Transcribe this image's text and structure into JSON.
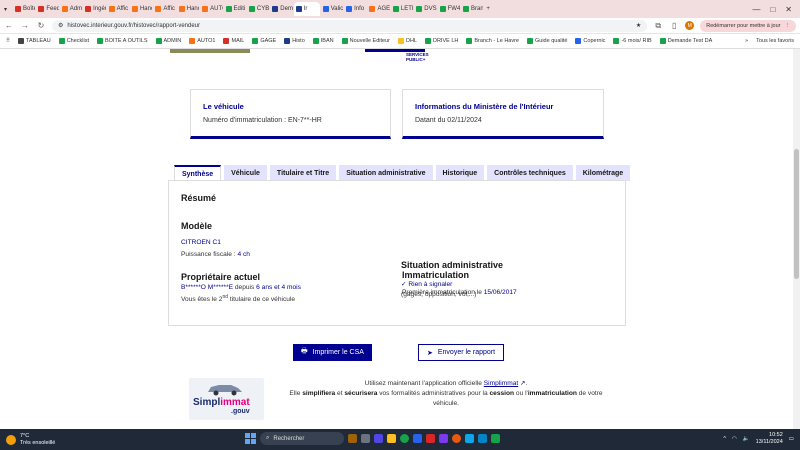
{
  "browser": {
    "tabs": [
      {
        "label": "Boîte",
        "color": "#d93025"
      },
      {
        "label": "Feedl",
        "color": "#d93025"
      },
      {
        "label": "Admi",
        "color": "#f97316"
      },
      {
        "label": "Ingér",
        "color": "#d93025"
      },
      {
        "label": "Affic",
        "color": "#f97316"
      },
      {
        "label": "Hano",
        "color": "#f97316"
      },
      {
        "label": "Affic",
        "color": "#f97316"
      },
      {
        "label": "Hano",
        "color": "#f97316"
      },
      {
        "label": "AUTC",
        "color": "#f97316"
      },
      {
        "label": "Editi",
        "color": "#16a34a"
      },
      {
        "label": "CYBI",
        "color": "#16a34a"
      },
      {
        "label": "Dem",
        "color": "#1e3a8a"
      },
      {
        "label": "Ir",
        "color": "#1e3a8a",
        "active": true
      },
      {
        "label": "Valic",
        "color": "#2563eb"
      },
      {
        "label": "Info",
        "color": "#2563eb"
      },
      {
        "label": "AGE",
        "color": "#f97316"
      },
      {
        "label": "LETI",
        "color": "#16a34a"
      },
      {
        "label": "DVSI",
        "color": "#16a34a"
      },
      {
        "label": "FW4",
        "color": "#16a34a"
      },
      {
        "label": "Bran",
        "color": "#16a34a"
      }
    ],
    "new_tab": "+",
    "window_controls": {
      "minimize": "—",
      "maximize": "□",
      "close": "✕"
    },
    "url": "histovec.interieur.gouv.fr/histovec/rapport-vendeur",
    "restart_label": "Redémarrer pour mettre à jour",
    "avatar_letter": "M",
    "more_menu": "⋮",
    "bookmarks": [
      {
        "label": "TABLEAU",
        "color": "#444"
      },
      {
        "label": "Checklist",
        "color": "#16a34a"
      },
      {
        "label": "BOITE A OUTILS",
        "color": "#16a34a"
      },
      {
        "label": "ADMIN",
        "color": "#16a34a"
      },
      {
        "label": "AUTO1",
        "color": "#f97316"
      },
      {
        "label": "MAIL",
        "color": "#d93025"
      },
      {
        "label": "GAGE",
        "color": "#16a34a"
      },
      {
        "label": "Histo",
        "color": "#1e3a8a"
      },
      {
        "label": "IBAN",
        "color": "#16a34a"
      },
      {
        "label": "Nouvelle Editeur",
        "color": "#16a34a"
      },
      {
        "label": "DHL",
        "color": "#fbbf24"
      },
      {
        "label": "DRIVE LH",
        "color": "#16a34a"
      },
      {
        "label": "Branch - Le Havre",
        "color": "#16a34a"
      },
      {
        "label": "Guide qualité",
        "color": "#16a34a"
      },
      {
        "label": "Copernic",
        "color": "#2563eb"
      },
      {
        "label": "-6 mois/ RIB",
        "color": "#16a34a"
      },
      {
        "label": "Demande Test DA",
        "color": "#16a34a"
      }
    ],
    "bookmarks_more": "»",
    "all_bookmarks": "Tous les favoris"
  },
  "header": {
    "logo_text": "SERVICES PUBLIC+"
  },
  "cards": {
    "vehicle": {
      "title": "Le véhicule",
      "text": "Numéro d'immatriculation : EN-7**-HR"
    },
    "ministry": {
      "title": "Informations du Ministère de l'Intérieur",
      "text": "Datant du 02/11/2024"
    }
  },
  "tabs": [
    "Synthèse",
    "Véhicule",
    "Titulaire et Titre",
    "Situation administrative",
    "Historique",
    "Contrôles techniques",
    "Kilométrage"
  ],
  "summary": {
    "title": "Résumé",
    "model_heading": "Modèle",
    "model": "CITROEN C1",
    "power_label": "Puissance fiscale : ",
    "power_value": "4 ch",
    "owner_heading": "Propriétaire actuel",
    "owner_name": "B******O M******E",
    "owner_since_pre": "depuis",
    "owner_since": "6 ans et 4 mois",
    "holder_pre": "Vous êtes le ",
    "holder_rank": "2",
    "holder_sup": "nd",
    "holder_post": " titulaire de ce véhicule",
    "registration_heading": "Immatriculation",
    "first_registration_label": "Première immatriculation le ",
    "first_registration_date": "15/06/2017",
    "admin_heading": "Situation administrative",
    "admin_status": "Rien à signaler",
    "admin_detail": "(gages, opposition, vol,...)"
  },
  "actions": {
    "print": "Imprimer le CSA",
    "send": "Envoyer le rapport"
  },
  "promo": {
    "logo_main": "Simpl",
    "logo_accent": "immat",
    "logo_suffix": ".gouv",
    "line1_pre": "Utilisez maintenant l'application officielle ",
    "app_link": "Simplimmat",
    "line1_post": ".",
    "l2_a": "Elle ",
    "l2_b": "simplifiera",
    "l2_c": " et ",
    "l2_d": "sécurisera",
    "l2_e": " vos formalités administratives pour la ",
    "l2_f": "cession",
    "l2_g": " ou l'",
    "l2_h": "immatriculation",
    "l2_i": " de votre véhicule."
  },
  "taskbar": {
    "temperature": "7°C",
    "weather": "Très ensoleillé",
    "search_placeholder": "Rechercher",
    "time": "10:52",
    "date": "13/11/2024"
  }
}
